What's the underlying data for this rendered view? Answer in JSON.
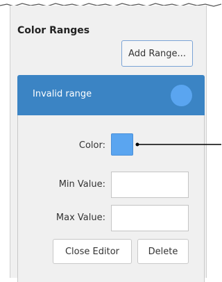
{
  "section_title": "Color Ranges",
  "add_range_label": "Add Range...",
  "range": {
    "name": "Invalid range",
    "color": "#5aa5f0"
  },
  "editor": {
    "color_label": "Color:",
    "min_label": "Min Value:",
    "min_value": "",
    "max_label": "Max Value:",
    "max_value": "",
    "close_label": "Close Editor",
    "delete_label": "Delete"
  },
  "colors": {
    "header_bg": "#3b84c4",
    "panel_bg": "#f0f0f0",
    "accent_border": "#7aa3d6"
  }
}
